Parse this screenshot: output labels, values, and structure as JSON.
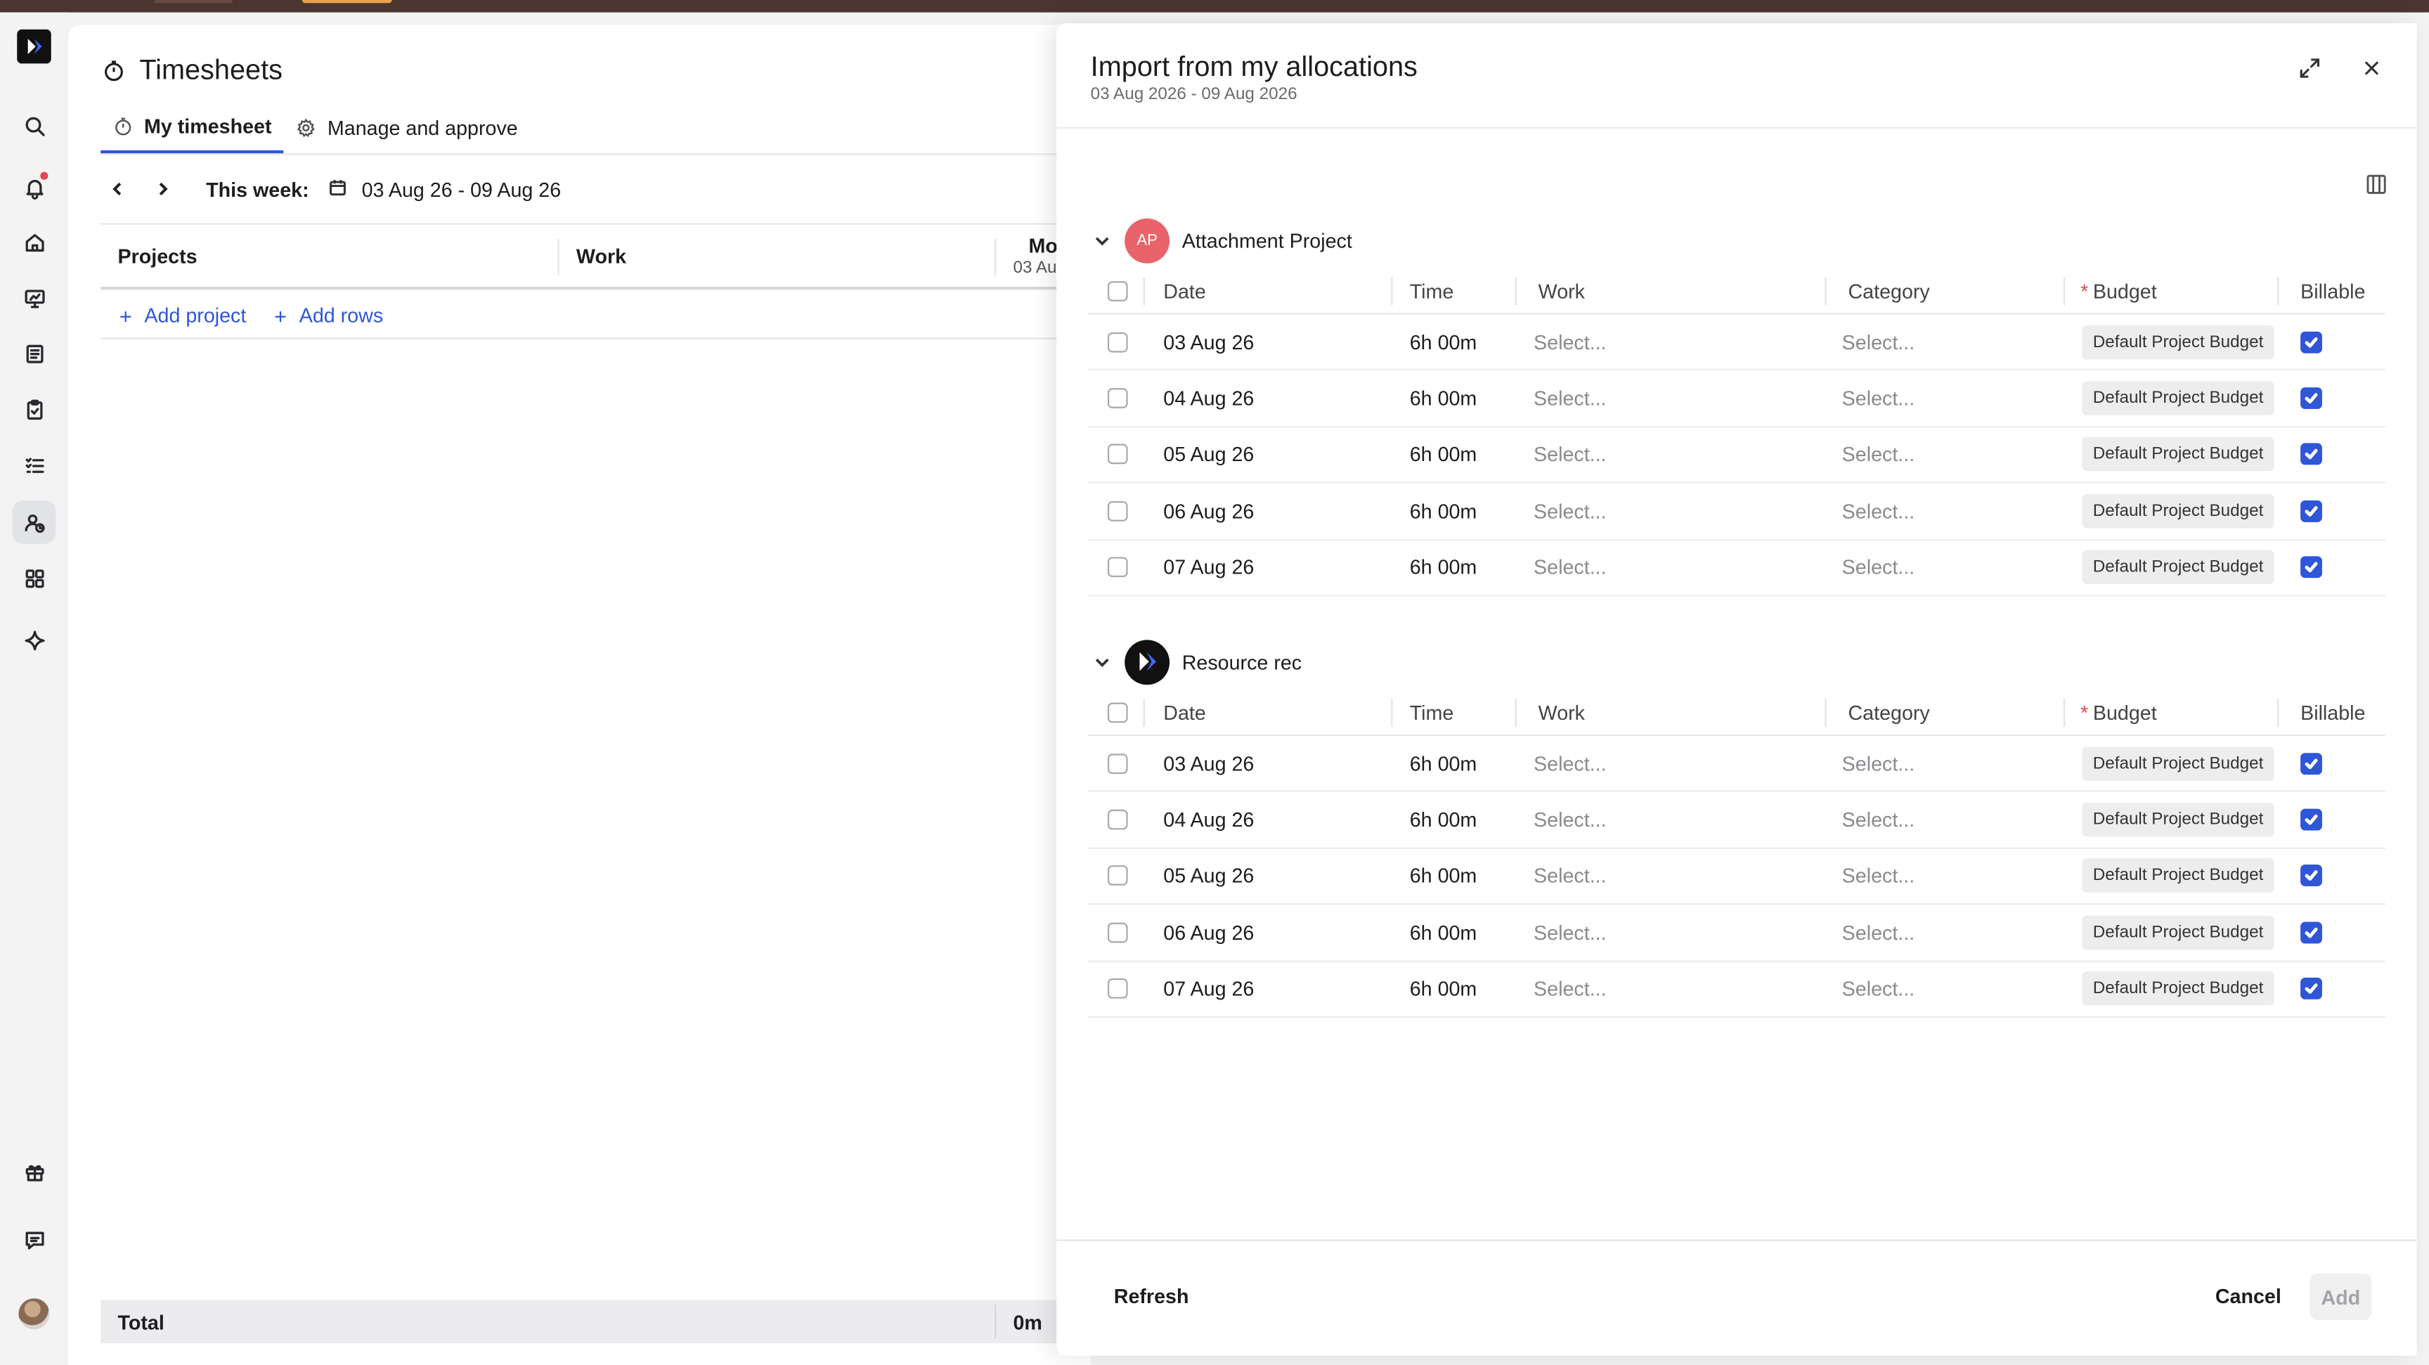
{
  "sidebar": {
    "items": [
      {
        "name": "search-icon"
      },
      {
        "name": "bell-icon",
        "badge": true
      },
      {
        "name": "home-icon"
      },
      {
        "name": "presentation-icon"
      },
      {
        "name": "book-icon"
      },
      {
        "name": "clipboard-icon"
      },
      {
        "name": "checklist-icon"
      },
      {
        "name": "user-time-icon",
        "active": true
      },
      {
        "name": "grid-icon"
      },
      {
        "name": "sparkle-icon"
      },
      {
        "name": "gift-icon"
      },
      {
        "name": "chat-icon"
      }
    ]
  },
  "header": {
    "title": "Timesheets",
    "tabs": [
      {
        "label": "My timesheet",
        "active": true
      },
      {
        "label": "Manage and approve",
        "active": false
      }
    ]
  },
  "week": {
    "label": "This week:",
    "range": "03 Aug 26 - 09 Aug 26"
  },
  "grid": {
    "col_projects": "Projects",
    "col_work": "Work",
    "col_day": "Mo",
    "col_day_sub": "03 Au",
    "add_project": "Add project",
    "add_rows": "Add rows",
    "total_label": "Total",
    "total_value": "0m"
  },
  "drawer": {
    "title": "Import from my allocations",
    "subtitle": "03 Aug 2026 - 09 Aug 2026",
    "headers": {
      "date": "Date",
      "time": "Time",
      "work": "Work",
      "category": "Category",
      "budget": "Budget",
      "billable": "Billable"
    },
    "groups": [
      {
        "name": "Attachment Project",
        "avatar_text": "AP",
        "avatar_color": "#e9646a",
        "rows": [
          {
            "date": "03 Aug 26",
            "time": "6h 00m",
            "work": "Select...",
            "category": "Select...",
            "budget": "Default Project Budget",
            "billable": true
          },
          {
            "date": "04 Aug 26",
            "time": "6h 00m",
            "work": "Select...",
            "category": "Select...",
            "budget": "Default Project Budget",
            "billable": true
          },
          {
            "date": "05 Aug 26",
            "time": "6h 00m",
            "work": "Select...",
            "category": "Select...",
            "budget": "Default Project Budget",
            "billable": true
          },
          {
            "date": "06 Aug 26",
            "time": "6h 00m",
            "work": "Select...",
            "category": "Select...",
            "budget": "Default Project Budget",
            "billable": true
          },
          {
            "date": "07 Aug 26",
            "time": "6h 00m",
            "work": "Select...",
            "category": "Select...",
            "budget": "Default Project Budget",
            "billable": true
          }
        ]
      },
      {
        "name": "Resource rec",
        "avatar_text": "",
        "avatar_color": "#111111",
        "rows": [
          {
            "date": "03 Aug 26",
            "time": "6h 00m",
            "work": "Select...",
            "category": "Select...",
            "budget": "Default Project Budget",
            "billable": true
          },
          {
            "date": "04 Aug 26",
            "time": "6h 00m",
            "work": "Select...",
            "category": "Select...",
            "budget": "Default Project Budget",
            "billable": true
          },
          {
            "date": "05 Aug 26",
            "time": "6h 00m",
            "work": "Select...",
            "category": "Select...",
            "budget": "Default Project Budget",
            "billable": true
          },
          {
            "date": "06 Aug 26",
            "time": "6h 00m",
            "work": "Select...",
            "category": "Select...",
            "budget": "Default Project Budget",
            "billable": true
          },
          {
            "date": "07 Aug 26",
            "time": "6h 00m",
            "work": "Select...",
            "category": "Select...",
            "budget": "Default Project Budget",
            "billable": true
          }
        ]
      }
    ],
    "footer": {
      "refresh": "Refresh",
      "cancel": "Cancel",
      "add": "Add"
    }
  },
  "colors": {
    "accent": "#2f56d6",
    "notification": "#e5484d"
  }
}
